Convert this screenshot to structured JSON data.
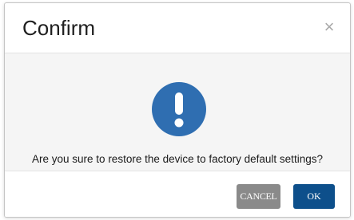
{
  "dialog": {
    "title": "Confirm",
    "close_label": "×",
    "message": "Are you sure to restore the device to factory default settings?",
    "icon": "exclamation-circle-icon",
    "buttons": {
      "cancel_label": "CANCEL",
      "ok_label": "OK"
    }
  },
  "colors": {
    "alert_icon": "#2f6eb1",
    "ok_button": "#0d4f8b",
    "cancel_button": "#8a8a8a",
    "body_background": "#f5f5f5"
  }
}
